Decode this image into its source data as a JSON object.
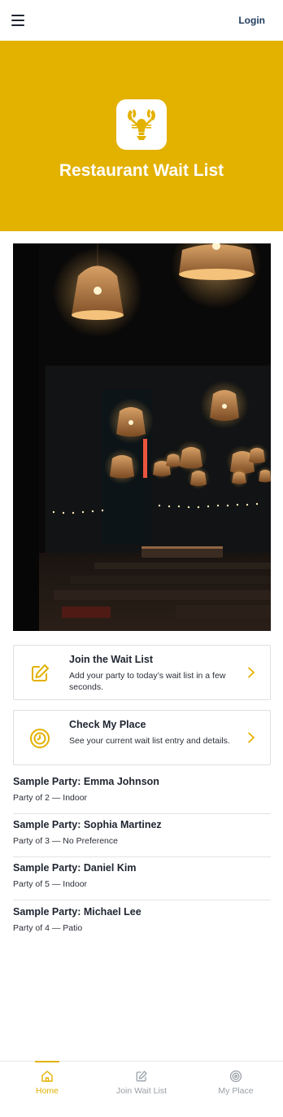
{
  "header": {
    "login_label": "Login",
    "menu_icon": "hamburger-menu-icon"
  },
  "hero": {
    "title": "Restaurant Wait List",
    "logo_icon": "lobster-logo-icon",
    "background": "#e3b100"
  },
  "actions": [
    {
      "title": "Join the Wait List",
      "description": "Add your party to today’s wait list in a few seconds.",
      "icon": "edit-pencil-icon"
    },
    {
      "title": "Check My Place",
      "description": "See your current wait list entry and details.",
      "icon": "clock-icon"
    }
  ],
  "parties": [
    {
      "name": "Sample Party: Emma Johnson",
      "detail": "Party of 2 — Indoor"
    },
    {
      "name": "Sample Party: Sophia Martinez",
      "detail": "Party of 3 — No Preference"
    },
    {
      "name": "Sample Party: Daniel Kim",
      "detail": "Party of 5 — Indoor"
    },
    {
      "name": "Sample Party: Michael Lee",
      "detail": "Party of 4 — Patio"
    }
  ],
  "bottom_nav": [
    {
      "label": "Home",
      "icon": "home-icon",
      "active": true
    },
    {
      "label": "Join Wait List",
      "icon": "edit-pencil-icon",
      "active": false
    },
    {
      "label": "My Place",
      "icon": "target-icon",
      "active": false
    }
  ],
  "colors": {
    "accent": "#e3b100",
    "text": "#1f2430",
    "muted": "#9aa0a6"
  }
}
